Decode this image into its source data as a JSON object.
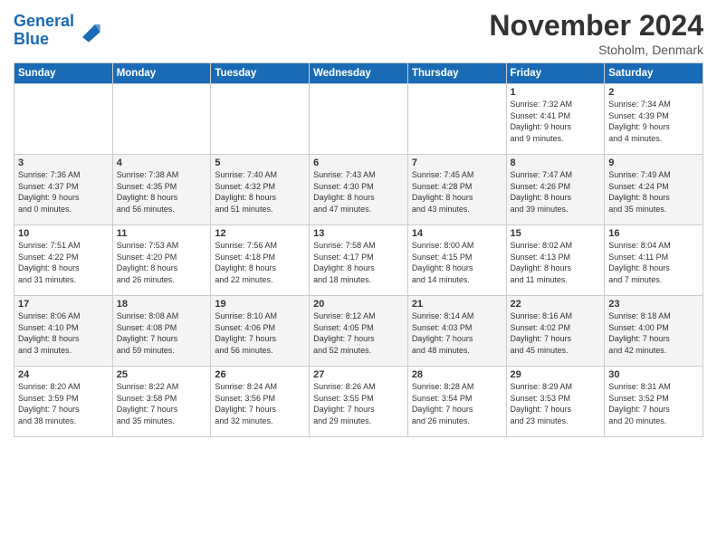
{
  "header": {
    "logo_line1": "General",
    "logo_line2": "Blue",
    "month_title": "November 2024",
    "location": "Stoholm, Denmark"
  },
  "weekdays": [
    "Sunday",
    "Monday",
    "Tuesday",
    "Wednesday",
    "Thursday",
    "Friday",
    "Saturday"
  ],
  "weeks": [
    [
      {
        "day": "",
        "info": ""
      },
      {
        "day": "",
        "info": ""
      },
      {
        "day": "",
        "info": ""
      },
      {
        "day": "",
        "info": ""
      },
      {
        "day": "",
        "info": ""
      },
      {
        "day": "1",
        "info": "Sunrise: 7:32 AM\nSunset: 4:41 PM\nDaylight: 9 hours\nand 9 minutes."
      },
      {
        "day": "2",
        "info": "Sunrise: 7:34 AM\nSunset: 4:39 PM\nDaylight: 9 hours\nand 4 minutes."
      }
    ],
    [
      {
        "day": "3",
        "info": "Sunrise: 7:36 AM\nSunset: 4:37 PM\nDaylight: 9 hours\nand 0 minutes."
      },
      {
        "day": "4",
        "info": "Sunrise: 7:38 AM\nSunset: 4:35 PM\nDaylight: 8 hours\nand 56 minutes."
      },
      {
        "day": "5",
        "info": "Sunrise: 7:40 AM\nSunset: 4:32 PM\nDaylight: 8 hours\nand 51 minutes."
      },
      {
        "day": "6",
        "info": "Sunrise: 7:43 AM\nSunset: 4:30 PM\nDaylight: 8 hours\nand 47 minutes."
      },
      {
        "day": "7",
        "info": "Sunrise: 7:45 AM\nSunset: 4:28 PM\nDaylight: 8 hours\nand 43 minutes."
      },
      {
        "day": "8",
        "info": "Sunrise: 7:47 AM\nSunset: 4:26 PM\nDaylight: 8 hours\nand 39 minutes."
      },
      {
        "day": "9",
        "info": "Sunrise: 7:49 AM\nSunset: 4:24 PM\nDaylight: 8 hours\nand 35 minutes."
      }
    ],
    [
      {
        "day": "10",
        "info": "Sunrise: 7:51 AM\nSunset: 4:22 PM\nDaylight: 8 hours\nand 31 minutes."
      },
      {
        "day": "11",
        "info": "Sunrise: 7:53 AM\nSunset: 4:20 PM\nDaylight: 8 hours\nand 26 minutes."
      },
      {
        "day": "12",
        "info": "Sunrise: 7:56 AM\nSunset: 4:18 PM\nDaylight: 8 hours\nand 22 minutes."
      },
      {
        "day": "13",
        "info": "Sunrise: 7:58 AM\nSunset: 4:17 PM\nDaylight: 8 hours\nand 18 minutes."
      },
      {
        "day": "14",
        "info": "Sunrise: 8:00 AM\nSunset: 4:15 PM\nDaylight: 8 hours\nand 14 minutes."
      },
      {
        "day": "15",
        "info": "Sunrise: 8:02 AM\nSunset: 4:13 PM\nDaylight: 8 hours\nand 11 minutes."
      },
      {
        "day": "16",
        "info": "Sunrise: 8:04 AM\nSunset: 4:11 PM\nDaylight: 8 hours\nand 7 minutes."
      }
    ],
    [
      {
        "day": "17",
        "info": "Sunrise: 8:06 AM\nSunset: 4:10 PM\nDaylight: 8 hours\nand 3 minutes."
      },
      {
        "day": "18",
        "info": "Sunrise: 8:08 AM\nSunset: 4:08 PM\nDaylight: 7 hours\nand 59 minutes."
      },
      {
        "day": "19",
        "info": "Sunrise: 8:10 AM\nSunset: 4:06 PM\nDaylight: 7 hours\nand 56 minutes."
      },
      {
        "day": "20",
        "info": "Sunrise: 8:12 AM\nSunset: 4:05 PM\nDaylight: 7 hours\nand 52 minutes."
      },
      {
        "day": "21",
        "info": "Sunrise: 8:14 AM\nSunset: 4:03 PM\nDaylight: 7 hours\nand 48 minutes."
      },
      {
        "day": "22",
        "info": "Sunrise: 8:16 AM\nSunset: 4:02 PM\nDaylight: 7 hours\nand 45 minutes."
      },
      {
        "day": "23",
        "info": "Sunrise: 8:18 AM\nSunset: 4:00 PM\nDaylight: 7 hours\nand 42 minutes."
      }
    ],
    [
      {
        "day": "24",
        "info": "Sunrise: 8:20 AM\nSunset: 3:59 PM\nDaylight: 7 hours\nand 38 minutes."
      },
      {
        "day": "25",
        "info": "Sunrise: 8:22 AM\nSunset: 3:58 PM\nDaylight: 7 hours\nand 35 minutes."
      },
      {
        "day": "26",
        "info": "Sunrise: 8:24 AM\nSunset: 3:56 PM\nDaylight: 7 hours\nand 32 minutes."
      },
      {
        "day": "27",
        "info": "Sunrise: 8:26 AM\nSunset: 3:55 PM\nDaylight: 7 hours\nand 29 minutes."
      },
      {
        "day": "28",
        "info": "Sunrise: 8:28 AM\nSunset: 3:54 PM\nDaylight: 7 hours\nand 26 minutes."
      },
      {
        "day": "29",
        "info": "Sunrise: 8:29 AM\nSunset: 3:53 PM\nDaylight: 7 hours\nand 23 minutes."
      },
      {
        "day": "30",
        "info": "Sunrise: 8:31 AM\nSunset: 3:52 PM\nDaylight: 7 hours\nand 20 minutes."
      }
    ]
  ]
}
